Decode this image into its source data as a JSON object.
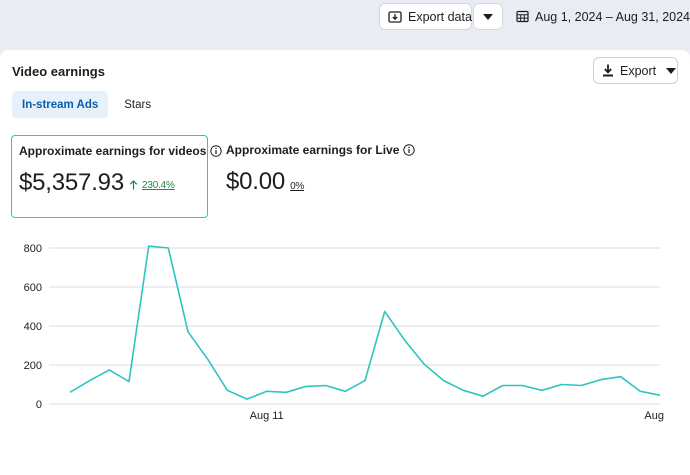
{
  "header": {
    "export_data_label": "Export data",
    "date_range_label": "Aug 1, 2024 – Aug 31, 2024"
  },
  "card": {
    "title": "Video earnings",
    "export_label": "Export",
    "tabs": [
      {
        "label": "In-stream Ads",
        "active": true
      },
      {
        "label": "Stars",
        "active": false
      }
    ],
    "metrics": [
      {
        "label": "Approximate earnings for videos",
        "value": "$5,357.93",
        "delta": "230.4%",
        "direction": "up"
      },
      {
        "label": "Approximate earnings for Live",
        "value": "$0.00",
        "delta": "0%",
        "direction": "flat"
      }
    ]
  },
  "colors": {
    "accent": "#2fc4c0",
    "tab_active_bg": "#e7f1fb",
    "tab_active_text": "#0a5ea8",
    "positive": "#1b8a4a"
  },
  "chart_data": {
    "type": "line",
    "x": [
      1,
      2,
      3,
      4,
      5,
      6,
      7,
      8,
      9,
      10,
      11,
      12,
      13,
      14,
      15,
      16,
      17,
      18,
      19,
      20,
      21,
      22,
      23,
      24,
      25,
      26,
      27,
      28,
      29,
      30,
      31
    ],
    "values": [
      60,
      120,
      175,
      115,
      810,
      800,
      370,
      230,
      70,
      25,
      65,
      60,
      90,
      95,
      65,
      120,
      475,
      330,
      205,
      120,
      70,
      40,
      95,
      95,
      70,
      100,
      95,
      125,
      140,
      65,
      45
    ],
    "ylim": [
      0,
      800
    ],
    "yticks": [
      "0",
      "200",
      "400",
      "600",
      "800"
    ],
    "xtick_labels": [
      "Aug 11",
      "Aug"
    ],
    "line_color": "#2fc4c0",
    "grid": true
  }
}
